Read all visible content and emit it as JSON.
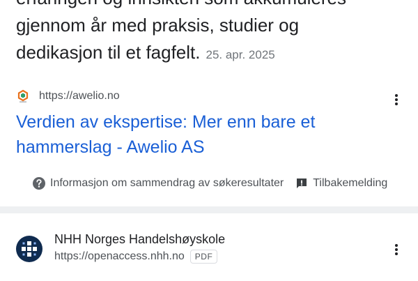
{
  "snippet": {
    "lines": [
      "erfaringen og innsikten som akkumuleres",
      "gjennom år med praksis, studier og",
      "dedikasjon til et fagfelt."
    ],
    "date": "25. apr. 2025"
  },
  "result1": {
    "url": "https://awelio.no",
    "title_lines": [
      "Verdien av ekspertise: Mer enn bare et",
      "hammerslag - Awelio AS"
    ],
    "favicon_icon": "awelio-logo-icon",
    "menu_icon": "more-vertical-icon"
  },
  "footer": {
    "info_label": "Informasjon om sammendrag av søkeresultater",
    "info_icon": "help-circle-icon",
    "feedback_label": "Tilbakemelding",
    "feedback_icon": "feedback-icon"
  },
  "result2": {
    "site_name": "NHH Norges Handelshøyskole",
    "url": "https://openaccess.nhh.no",
    "badge": "PDF",
    "favicon_icon": "nhh-logo-icon",
    "menu_icon": "more-vertical-icon"
  },
  "colors": {
    "link": "#1a5fd6",
    "text": "#202124",
    "secondary": "#4d5156",
    "divider": "#eef0f2",
    "nhh_logo_bg": "#0f2b4f"
  }
}
